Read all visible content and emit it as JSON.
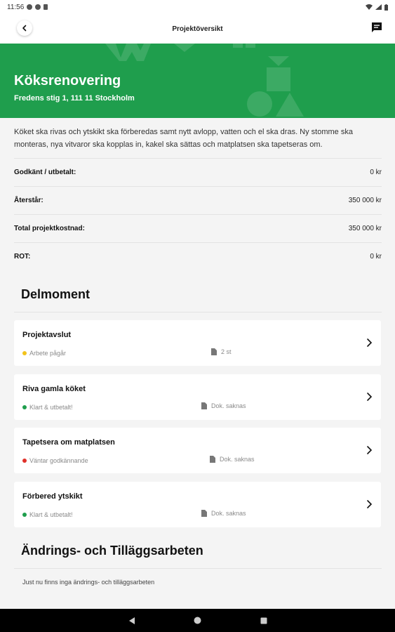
{
  "statusbar": {
    "time": "11:56"
  },
  "appbar": {
    "title": "Projektöversikt",
    "back_icon": "chevron-left-icon",
    "chat_icon": "chat-bubble-icon"
  },
  "hero": {
    "title": "Köksrenovering",
    "address": "Fredens stig 1, 111 11 Stockholm",
    "color": "#1f9e4d"
  },
  "description": "Köket ska rivas och ytskikt ska förberedas samt nytt avlopp, vatten och el ska dras. Ny stomme ska monteras, nya vitvaror ska kopplas in, kakel ska sättas och matplatsen ska tapetseras om.",
  "summary": [
    {
      "label": "Godkänt / utbetalt:",
      "value": "0 kr"
    },
    {
      "label": "Återstår:",
      "value": "350 000 kr"
    },
    {
      "label": "Total projektkostnad:",
      "value": "350 000 kr"
    },
    {
      "label": "ROT:",
      "value": "0 kr"
    }
  ],
  "delmoment": {
    "heading": "Delmoment",
    "items": [
      {
        "title": "Projektavslut",
        "status": "Arbete pågår",
        "status_color": "#f2c31b",
        "docs": "2 st"
      },
      {
        "title": "Riva gamla köket",
        "status": "Klart & utbetalt!",
        "status_color": "#1f9e4d",
        "docs": "Dok. saknas"
      },
      {
        "title": "Tapetsera om matplatsen",
        "status": "Väntar godkännande",
        "status_color": "#e0312a",
        "docs": "Dok. saknas"
      },
      {
        "title": "Förbered ytskikt",
        "status": "Klart & utbetalt!",
        "status_color": "#1f9e4d",
        "docs": "Dok. saknas"
      }
    ]
  },
  "andringar": {
    "heading": "Ändrings- och Tilläggsarbeten",
    "empty": "Just nu finns inga ändrings- och tilläggsarbeten"
  }
}
